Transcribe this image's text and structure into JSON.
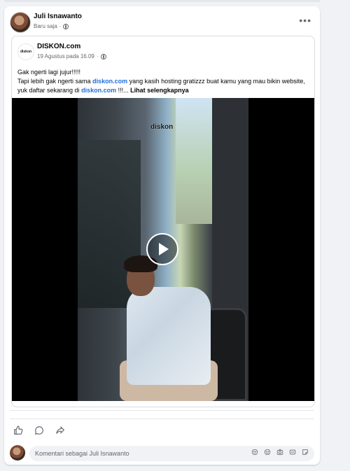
{
  "post": {
    "author": "Juli Isnawanto",
    "time": "Baru saja",
    "separator": "·"
  },
  "shared": {
    "page_name": "DISKON.com",
    "logo_text": "diskon",
    "date": "19 Agustus pada 16.09",
    "separator": "·",
    "text": {
      "line1": "Gak ngerti lagi jujur!!!!!",
      "p1": "Tapi lebih gak ngerti sama ",
      "link1": "diskon.com",
      "p2": " yang kasih hosting gratizzz  buat kamu yang mau bikin website, yuk daftar sekarang di ",
      "link2": "diskon.com",
      "p3": " !!!... ",
      "see_more": "Lihat selengkapnya"
    },
    "video": {
      "watermark": "diskon"
    }
  },
  "comment": {
    "placeholder": "Komentari sebagai Juli Isnawanto"
  },
  "icons": {
    "like": "like-icon",
    "comment": "comment-icon",
    "share": "share-icon",
    "avatar_sticker": "avatar-sticker-icon",
    "emoji": "emoji-icon",
    "camera": "camera-icon",
    "gif": "gif-icon",
    "sticker": "sticker-icon"
  },
  "colors": {
    "link": "#216fdb",
    "secondary_text": "#65676b",
    "background": "#f0f2f5"
  }
}
